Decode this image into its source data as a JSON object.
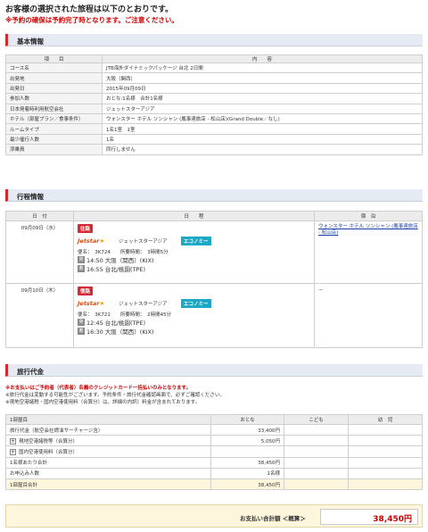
{
  "header": {
    "line1": "お客様の選択された旅程は以下のとおりです。",
    "line2": "※予約の確保は予約完了時となります。ご注意ください。"
  },
  "basic": {
    "title": "基本情報",
    "col_item": "項　　目",
    "col_content": "内　　容",
    "rows": [
      {
        "label": "コース名",
        "value": "JTB海外ダイナミックパッケージ 台北 2日間"
      },
      {
        "label": "出発地",
        "value": "大阪（関西）"
      },
      {
        "label": "出発日",
        "value": "2015年09月09日"
      },
      {
        "label": "参加人数",
        "value": "おとな:1名様　合計1名様"
      },
      {
        "label": "日本発着時利用航空会社",
        "value": "ジェットスターアジア"
      },
      {
        "label": "ホテル（部屋プラン／食事条件）",
        "value": "ウォンスター ホテル ソンシャン (鳳事達旅店 - 松山店)(Grand Double／なし)"
      },
      {
        "label": "ルームタイプ",
        "value": "1名1室　1室"
      },
      {
        "label": "最少催行人数",
        "value": "1名"
      },
      {
        "label": "添乗員",
        "value": "同行しません"
      }
    ]
  },
  "itinerary": {
    "title": "行程情報",
    "col_date": "日　付",
    "col_schedule": "日　　程",
    "col_stay": "宿　泊",
    "days": [
      {
        "date": "09月09日（水）",
        "badge": "往路",
        "airline_logo": "Jetstar",
        "airline_name": "ジェットスターアジア",
        "cabin": "エコノミー",
        "flight": "便名：　3K724　　所要時間：　3時間5分",
        "dep_icon": "発",
        "dep": "14:50 大阪（関西）(KIX)",
        "arr_icon": "着",
        "arr": "16:55 台北/桃園(TPE)",
        "stay": "ウォンスター ホテル ソンシャン (鳳事達旅店 - 松山店)"
      },
      {
        "date": "09月10日（木）",
        "badge": "復路",
        "airline_logo": "Jetstar",
        "airline_name": "ジェットスターアジア",
        "cabin": "エコノミー",
        "flight": "便名：　3K721　　所要時間：　2時間45分",
        "dep_icon": "発",
        "dep": "12:45 台北/桃園(TPE)",
        "arr_icon": "着",
        "arr": "16:30 大阪（関西）(KIX)",
        "stay": "－"
      }
    ]
  },
  "fare": {
    "title": "旅行代金",
    "note1": "※お支払いはご予約者（代表者）名義のクレジットカード一括払いのみとなります。",
    "note2": "※旅行代金は変動する可能性がございます。予約条件・旅行代金確認画面で、必ずご確認ください。",
    "note3": "※現地空港諸税・国内空港使用料（合算分）は、詳細の内訳）料金が含まれております。",
    "col_category": "1部屋目",
    "col_adult": "おとな",
    "col_child": "こども",
    "col_infant": "幼　児",
    "rows": [
      {
        "label": "旅行代金（航空会社燃油サーチャージ含）",
        "adult": "33,400円",
        "expand": false
      },
      {
        "label": "現地空港諸税等（合算分）",
        "adult": "5,050円",
        "expand": true
      },
      {
        "label": "国内空港使用料（合算分）",
        "adult": "",
        "expand": true
      },
      {
        "label": "1名様あたり合計",
        "adult": "38,450円",
        "expand": false
      },
      {
        "label": "お申込み人数",
        "adult": "1名様",
        "expand": false
      },
      {
        "label": "1部屋目合計",
        "adult": "38,450円",
        "expand": false
      }
    ],
    "pay_label": "お支払い合計額 ＜概算＞",
    "pay_total": "38,450円"
  }
}
